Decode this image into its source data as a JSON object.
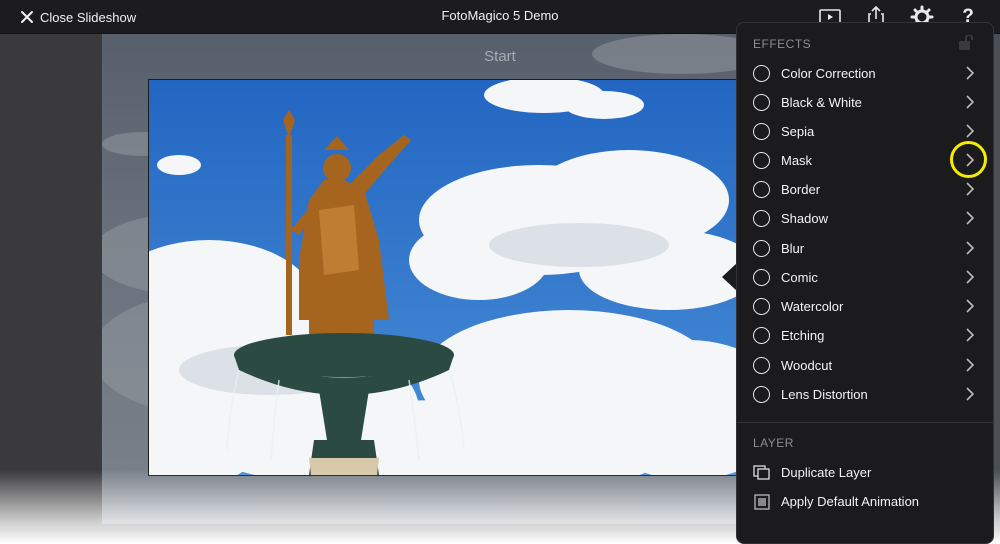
{
  "topbar": {
    "close_label": "Close Slideshow",
    "title": "FotoMagico 5 Demo",
    "help_glyph": "?"
  },
  "stage": {
    "start_label": "Start"
  },
  "panel": {
    "effects_title": "EFFECTS",
    "effects": [
      {
        "label": "Color Correction"
      },
      {
        "label": "Black & White"
      },
      {
        "label": "Sepia"
      },
      {
        "label": "Mask"
      },
      {
        "label": "Border"
      },
      {
        "label": "Shadow"
      },
      {
        "label": "Blur"
      },
      {
        "label": "Comic"
      },
      {
        "label": "Watercolor"
      },
      {
        "label": "Etching"
      },
      {
        "label": "Woodcut"
      },
      {
        "label": "Lens Distortion"
      }
    ],
    "layer_title": "LAYER",
    "layer_items": [
      {
        "label": "Duplicate Layer"
      },
      {
        "label": "Apply Default Animation"
      }
    ]
  },
  "colors": {
    "highlight": "#f5ec00",
    "panel_bg": "#1b1b1d",
    "sky": "#2a72c8"
  },
  "icons": [
    "close-icon",
    "play-preview-icon",
    "share-icon",
    "gear-icon",
    "help-icon",
    "lock-icon",
    "chevron-right-icon",
    "duplicate-layer-icon",
    "apply-animation-icon"
  ]
}
